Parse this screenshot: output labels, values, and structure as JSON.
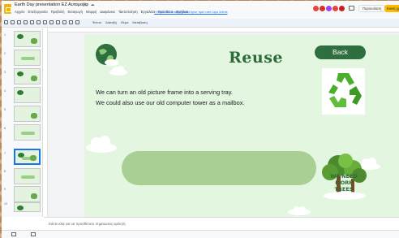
{
  "titlebar": {
    "doc_title": "Earth Day presentation ΕΖ Αυτομορφ",
    "menu": [
      "Αρχείο",
      "Επεξεργασία",
      "Προβολή",
      "Εισαγωγή",
      "Μορφή",
      "Διαφάνεια",
      "Τακτοποίηση",
      "Εργαλεία",
      "Πρόσθετα",
      "Βοήθεια"
    ],
    "last_edit": "Η τελευταία επεξεργασία έγινε πριν από λίγα λεπτά",
    "present_label": "Παρουσίαση",
    "share_label": "Κοινή χρ"
  },
  "toolbar": {
    "text_items": [
      "Φόντο",
      "Διάταξη",
      "Θέμα",
      "Μετάβαση"
    ]
  },
  "filmstrip": {
    "slide_numbers": [
      "1",
      "2",
      "3",
      "4",
      "5",
      "6",
      "7",
      "8",
      "9",
      "10",
      "11"
    ]
  },
  "slide": {
    "title": "Reuse",
    "back_label": "Back",
    "line1": "We can turn an old picture frame into a serving tray.",
    "line2": "We could also use our old computer tower as a mailbox.",
    "trees_text": "WE NEED MORE TREES"
  },
  "notes": {
    "placeholder": "Κάντε κλικ για να προσθέσετε σημειώσεις ομιλητή"
  },
  "colors": {
    "slide_bg": "#e3f6e0",
    "title_green": "#2e6b3a",
    "back_button": "#2e6e3f",
    "pill": "#a9cf94",
    "share": "#fbbc04"
  }
}
